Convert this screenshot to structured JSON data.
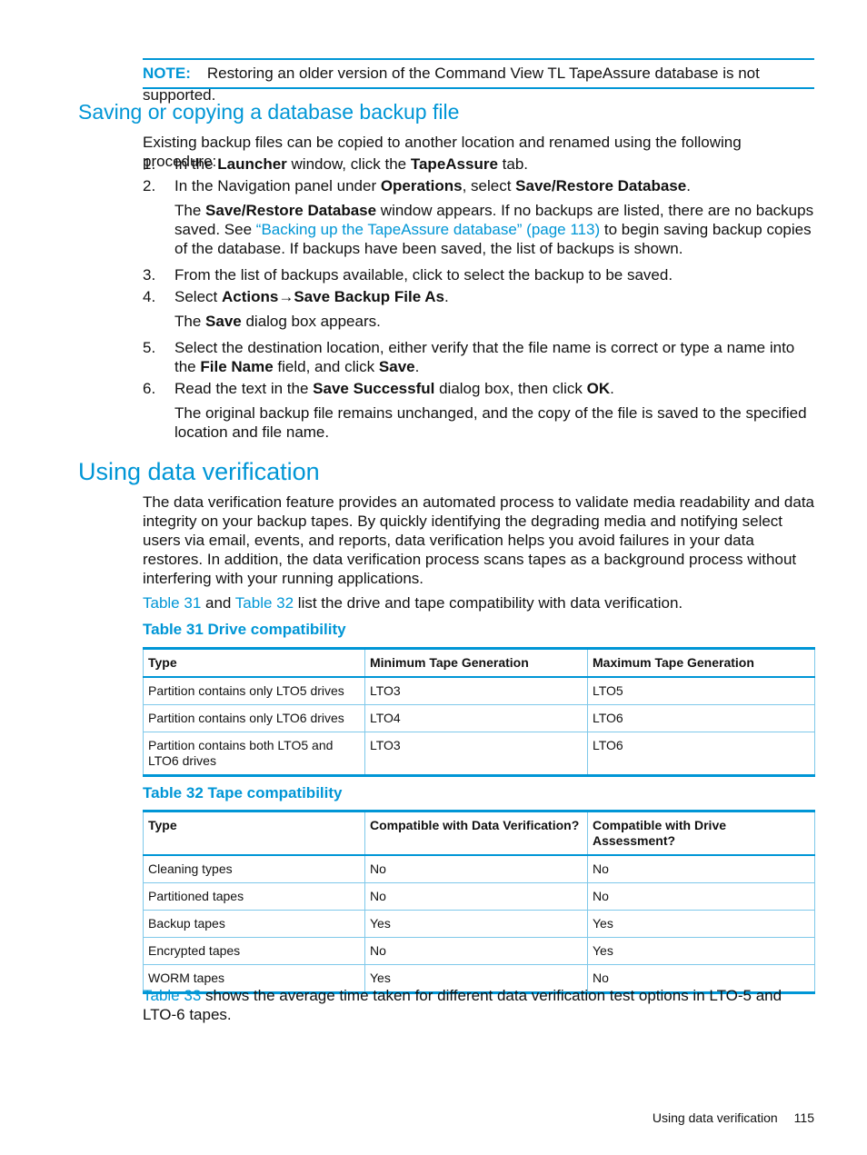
{
  "note": {
    "label": "NOTE:",
    "text": "Restoring an older version of the Command View TL TapeAssure database is not supported."
  },
  "section1": {
    "title": "Saving or copying a database backup file",
    "intro": "Existing backup files can be copied to another location and renamed using the following procedure:",
    "steps": [
      {
        "n": "1.",
        "parts": [
          "In the ",
          "Launcher",
          " window, click the ",
          "TapeAssure",
          " tab."
        ]
      },
      {
        "n": "2.",
        "parts": [
          "In the Navigation panel under ",
          "Operations",
          ", select ",
          "Save/Restore Database",
          "."
        ]
      },
      {
        "n": "3.",
        "text": "From the list of backups available, click to select the backup to be saved."
      },
      {
        "n": "4.",
        "parts": [
          "Select ",
          "Actions",
          "→",
          "Save Backup File As",
          "."
        ]
      },
      {
        "n": "5.",
        "parts": [
          "Select the destination location, either verify that the file name is correct or type a name into the ",
          "File Name",
          " field, and click ",
          "Save",
          "."
        ]
      },
      {
        "n": "6.",
        "parts": [
          "Read the text in the ",
          "Save Successful",
          " dialog box, then click ",
          "OK",
          "."
        ]
      }
    ],
    "sub2": {
      "pre": "The ",
      "bold": "Save/Restore Database",
      "mid": " window appears. If no backups are listed, there are no backups saved. See ",
      "link": "“Backing up the TapeAssure database” (page 113)",
      "post": " to begin saving backup copies of the database. If backups have been saved, the list of backups is shown."
    },
    "sub4": {
      "pre": "The ",
      "bold": "Save",
      "post": " dialog box appears."
    },
    "sub6": "The original backup file remains unchanged, and the copy of the file is saved to the specified location and file name."
  },
  "section2": {
    "title": "Using data verification",
    "para": "The data verification feature provides an automated process to validate media readability and data integrity on your backup tapes. By quickly identifying the degrading media and notifying select users via email, events, and reports, data verification helps you avoid failures in your data restores. In addition, the data verification process scans tapes as a background process without interfering with your running applications.",
    "ref": {
      "link1": "Table 31",
      "and": " and ",
      "link2": "Table 32",
      "post": " list the drive and tape compatibility with data verification."
    },
    "table31": {
      "caption": "Table 31 Drive compatibility",
      "headers": [
        "Type",
        "Minimum Tape Generation",
        "Maximum Tape Generation"
      ],
      "rows": [
        [
          "Partition contains only LTO5 drives",
          "LTO3",
          "LTO5"
        ],
        [
          "Partition contains only LTO6 drives",
          "LTO4",
          "LTO6"
        ],
        [
          "Partition contains both LTO5 and LTO6 drives",
          "LTO3",
          "LTO6"
        ]
      ]
    },
    "table32": {
      "caption": "Table 32 Tape compatibility",
      "headers": [
        "Type",
        "Compatible with Data Verification?",
        "Compatible with Drive Assessment?"
      ],
      "rows": [
        [
          "Cleaning types",
          "No",
          "No"
        ],
        [
          "Partitioned tapes",
          "No",
          "No"
        ],
        [
          "Backup tapes",
          "Yes",
          "Yes"
        ],
        [
          "Encrypted tapes",
          "No",
          "Yes"
        ],
        [
          "WORM tapes",
          "Yes",
          "No"
        ]
      ]
    },
    "closing": {
      "link": "Table 33",
      "post": " shows the average time taken for different data verification test options in LTO-5 and LTO-6 tapes."
    }
  },
  "footer": {
    "section": "Using data verification",
    "page": "115"
  }
}
